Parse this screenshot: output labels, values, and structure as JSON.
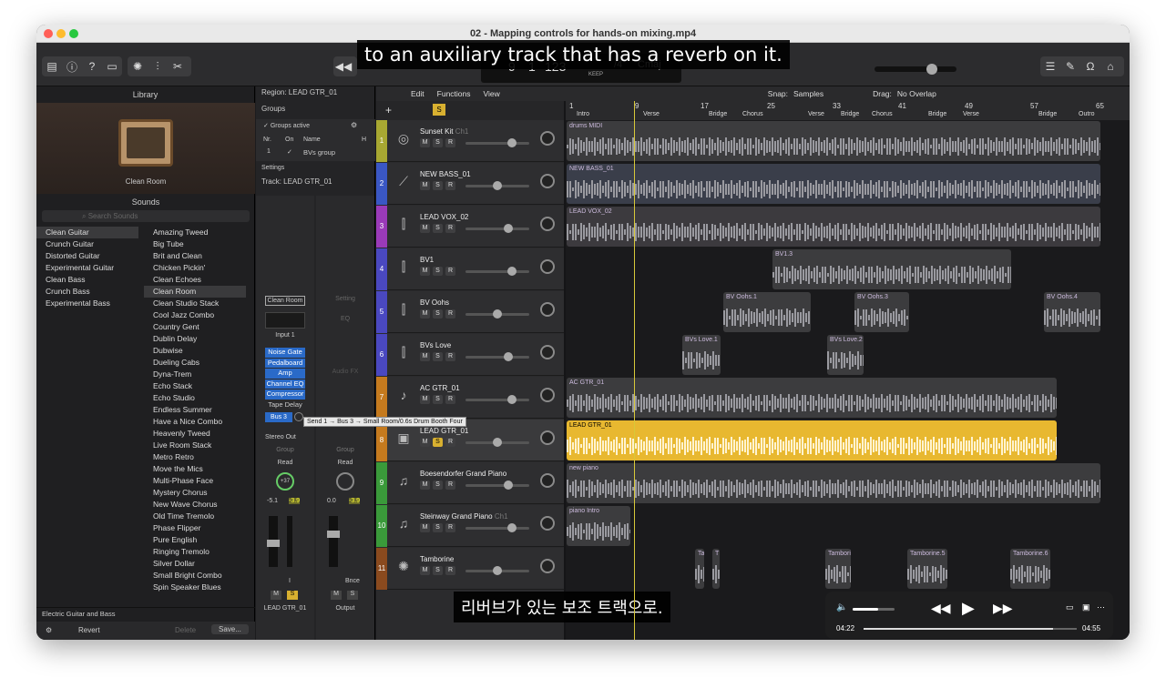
{
  "window": {
    "title": "02 - Mapping controls for hands-on mixing.mp4"
  },
  "subtitles": {
    "english": "to an auxiliary track that has a reverb on it.",
    "korean": "리버브가 있는 보조 트랙으로."
  },
  "lcd": {
    "bar": "9",
    "beat": "1",
    "div": "123",
    "keep_label": "KEEP",
    "key": "Cmaj",
    "time_sig": "/4",
    "tempo_label": "Tempo"
  },
  "library": {
    "title": "Library",
    "preview_name": "Clean Room",
    "sounds_label": "Sounds",
    "search_placeholder": "Search Sounds",
    "categories": [
      "Clean Guitar",
      "Crunch Guitar",
      "Distorted Guitar",
      "Experimental Guitar",
      "Clean Bass",
      "Crunch Bass",
      "Experimental Bass"
    ],
    "patches": [
      "Amazing Tweed",
      "Big Tube",
      "Brit and Clean",
      "Chicken Pickin'",
      "Clean Echoes",
      "Clean Room",
      "Clean Studio Stack",
      "Cool Jazz Combo",
      "Country Gent",
      "Dublin Delay",
      "Dubwise",
      "Dueling Cabs",
      "Dyna-Trem",
      "Echo Stack",
      "Echo Studio",
      "Endless Summer",
      "Have a Nice Combo",
      "Heavenly Tweed",
      "Live Room Stack",
      "Metro Retro",
      "Move the Mics",
      "Multi-Phase Face",
      "Mystery Chorus",
      "New Wave Chorus",
      "Old Time Tremolo",
      "Phase Flipper",
      "Pure English",
      "Ringing Tremolo",
      "Silver Dollar",
      "Small Bright Combo",
      "Spin Speaker Blues"
    ],
    "footer_path": "Electric Guitar and Bass",
    "revert": "Revert",
    "delete": "Delete",
    "save": "Save..."
  },
  "inspector": {
    "region": "Region: LEAD GTR_01",
    "groups": "Groups",
    "groups_active": "Groups active",
    "col_nr": "Nr.",
    "col_on": "On",
    "col_name": "Name",
    "col_h": "H",
    "group_nr": "1",
    "group_name": "BVs group",
    "settings": "Settings",
    "track": "Track:  LEAD GTR_01",
    "setting_btn": "Clean Room",
    "setting_btn2": "Setting",
    "eq": "EQ",
    "input": "Input 1",
    "plugins": [
      "Noise Gate",
      "Pedalboard",
      "Amp",
      "Channel EQ",
      "Compressor"
    ],
    "tape_delay": "Tape Delay",
    "audio_fx": "Audio FX",
    "bus": "Bus 3",
    "tooltip": "Send 1 → Bus 3 → Small Room/0.6s Drum Booth Four",
    "stereo_out": "Stereo Out",
    "group": "Group",
    "read": "Read",
    "pan1": "+37",
    "vol1": "-5.1",
    "peak1": "-3.9",
    "vol2": "0.0",
    "peak2": "-3.9",
    "bnce": "Bnce",
    "strip1_name": "LEAD GTR_01",
    "strip2_name": "Output",
    "m": "M",
    "s": "S",
    "i": "I"
  },
  "tracks_toolbar": {
    "edit": "Edit",
    "functions": "Functions",
    "view": "View",
    "snap_label": "Snap:",
    "snap_value": "Samples",
    "drag_label": "Drag:",
    "drag_value": "No Overlap"
  },
  "ruler": {
    "bars": [
      "1",
      "9",
      "17",
      "25",
      "33",
      "41",
      "49",
      "57",
      "65"
    ],
    "sections": [
      "Intro",
      "Verse",
      "Bridge",
      "Chorus",
      "Verse",
      "Bridge",
      "Chorus",
      "Bridge",
      "Verse",
      "Bridge",
      "Outro"
    ]
  },
  "tracks": [
    {
      "num": "1",
      "name": "Sunset Kit",
      "extra": "Ch1",
      "color": "#a8a832",
      "icon": "drum-kit-icon"
    },
    {
      "num": "2",
      "name": "NEW BASS_01",
      "extra": "",
      "color": "#3a57c4",
      "icon": "bass-guitar-icon"
    },
    {
      "num": "3",
      "name": "LEAD VOX_02",
      "extra": "",
      "color": "#9a3ab8",
      "icon": "microphone-icon"
    },
    {
      "num": "4",
      "name": "BV1",
      "extra": "",
      "color": "#4a48c0",
      "icon": "microphone-icon"
    },
    {
      "num": "5",
      "name": "BV Oohs",
      "extra": "",
      "color": "#4a48c0",
      "icon": "microphone-icon"
    },
    {
      "num": "6",
      "name": "BVs Love",
      "extra": "",
      "color": "#4a48c0",
      "icon": "microphone-icon"
    },
    {
      "num": "7",
      "name": "AC GTR_01",
      "extra": "",
      "color": "#c57a1e",
      "icon": "acoustic-guitar-icon"
    },
    {
      "num": "8",
      "name": "LEAD GTR_01",
      "extra": "",
      "color": "#c57a1e",
      "icon": "amp-icon"
    },
    {
      "num": "9",
      "name": "Boesendorfer Grand Piano",
      "extra": "",
      "color": "#3a9a3a",
      "icon": "piano-icon"
    },
    {
      "num": "10",
      "name": "Steinway Grand Piano",
      "extra": "Ch1",
      "color": "#3a9a3a",
      "icon": "piano-icon"
    },
    {
      "num": "11",
      "name": "Tamborine",
      "extra": "",
      "color": "#8a4a1e",
      "icon": "tambourine-icon"
    }
  ],
  "regions": {
    "drums": "drums MIDI",
    "bass": "NEW BASS_01",
    "vox": "LEAD VOX_02",
    "bv1": "BV1.3",
    "oohs1": "BV Oohs.1",
    "oohs3": "BV Oohs.3",
    "oohs4": "BV Oohs.4",
    "love1": "BVs Love.1",
    "love2": "BVs Love.2",
    "ac": "AC GTR_01",
    "lead": "LEAD GTR_01",
    "piano": "new piano",
    "piano_intro": "piano Intro",
    "tamb_a": "Ta",
    "tamb_t": "T",
    "tamb": "Tambori",
    "tamb5": "Tamborine.5",
    "tamb6": "Tamborine.6"
  },
  "player": {
    "elapsed": "04:22",
    "total": "04:55",
    "progress": 0.89,
    "volume": 0.6
  }
}
